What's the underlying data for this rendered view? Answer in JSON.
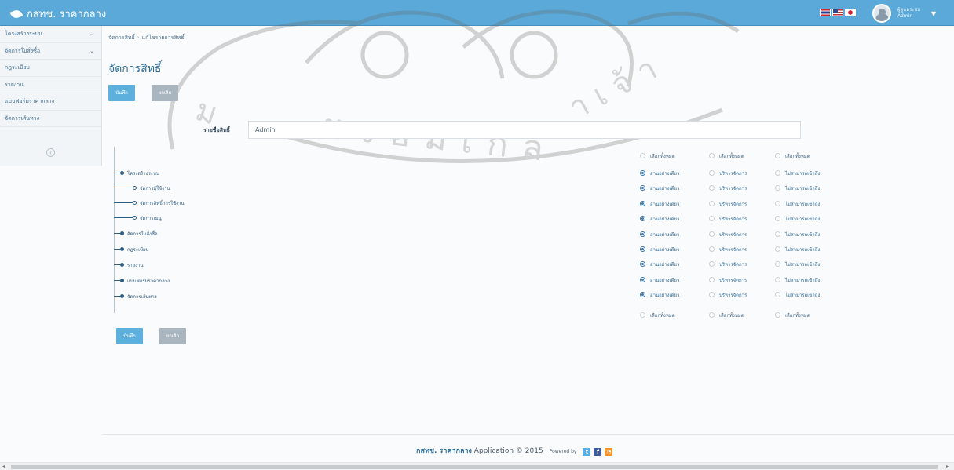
{
  "app": {
    "brand": "กสทช. ราคากลาง"
  },
  "header": {
    "flags": [
      "thai-flag-icon",
      "us-flag-icon",
      "japan-flag-icon"
    ],
    "user_name": "ผู้ดูแลระบบ",
    "user_role": "Admin"
  },
  "sidebar": {
    "items": [
      {
        "label": "โครงสร้างระบบ",
        "chevron": true
      },
      {
        "label": "จัดการใบสั่งซื้อ",
        "chevron": true
      },
      {
        "label": "กฎระเบียบ",
        "chevron": false
      },
      {
        "label": "รายงาน",
        "chevron": false
      },
      {
        "label": "แบบฟอร์มราคากลาง",
        "chevron": false
      },
      {
        "label": "จัดการเส้นทาง",
        "chevron": false
      }
    ],
    "toggle": "‹"
  },
  "breadcrumb": {
    "item1": "จัดการสิทธิ์",
    "separator": "›",
    "item2": "แก้ไขรายการสิทธิ์"
  },
  "page": {
    "title": "จัดการสิทธิ์"
  },
  "actions": {
    "save": "บันทึก",
    "cancel": "ยกเลิก"
  },
  "form": {
    "role_label": "รายชื่อสิทธิ์",
    "role_value": "Admin"
  },
  "tree": {
    "nodes": [
      {
        "label": "โครงสร้างระบบ",
        "child": false
      },
      {
        "label": "จัดการผู้ใช้งาน",
        "child": true
      },
      {
        "label": "จัดการสิทธิ์การใช้งาน",
        "child": true
      },
      {
        "label": "จัดการเมนู",
        "child": true
      },
      {
        "label": "จัดการใบสั่งซื้อ",
        "child": false
      },
      {
        "label": "กฎระเบียบ",
        "child": false
      },
      {
        "label": "รายงาน",
        "child": false
      },
      {
        "label": "แบบฟอร์มราคากลาง",
        "child": false
      },
      {
        "label": "จัดการเส้นทาง",
        "child": false
      }
    ]
  },
  "permissions": {
    "select_all_top": [
      "เลือกทั้งหมด",
      "เลือกทั้งหมด",
      "เลือกทั้งหมด"
    ],
    "options": [
      "อ่านอย่างเดียว",
      "บริหารจัดการ",
      "ไม่สามารถเข้าถึง"
    ],
    "selected_index": 0,
    "select_all_bottom": [
      "เลือกทั้งหมด",
      "เลือกทั้งหมด",
      "เลือกทั้งหมด"
    ]
  },
  "footer": {
    "brand": "กสทช. ราคากลาง",
    "text": " Application © 2015",
    "powered": "Powered by"
  },
  "colors": {
    "header": "#5aa9d8",
    "accent": "#2f6f9c",
    "save": "#5db0dc",
    "cancel": "#a9b5bf"
  }
}
